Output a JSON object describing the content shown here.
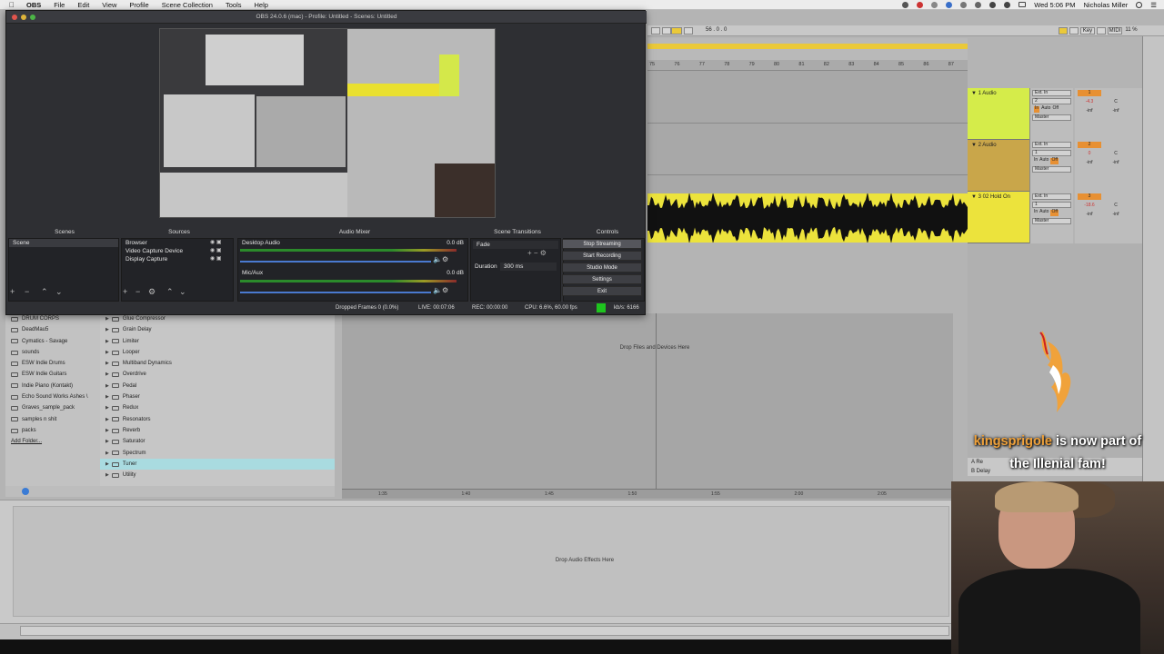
{
  "menubar": {
    "app": "OBS",
    "items": [
      "File",
      "Edit",
      "View",
      "Profile",
      "Scene Collection",
      "Tools",
      "Help"
    ],
    "clock": "Wed 5:06 PM",
    "user": "Nicholas Miller"
  },
  "obs": {
    "title": "OBS 24.0.6 (mac) - Profile: Untitled - Scenes: Untitled",
    "docks": {
      "scenes": "Scenes",
      "sources": "Sources",
      "mixer": "Audio Mixer",
      "transitions": "Scene Transitions",
      "controls": "Controls"
    },
    "scenes": [
      "Scene"
    ],
    "sources": [
      "Browser",
      "Video Capture Device",
      "Display Capture"
    ],
    "mixer": [
      {
        "name": "Desktop Audio",
        "db": "0.0 dB"
      },
      {
        "name": "Mic/Aux",
        "db": "0.0 dB"
      }
    ],
    "transition": {
      "type": "Fade",
      "duration_label": "Duration",
      "duration": "300 ms"
    },
    "controls": [
      "Stop Streaming",
      "Start Recording",
      "Studio Mode",
      "Settings",
      "Exit"
    ],
    "status": {
      "dropped": "Dropped Frames 0 (0.0%)",
      "live": "LIVE: 00:07:06",
      "rec": "REC: 00:00:00",
      "cpu": "CPU: 6.6%, 60.00 fps",
      "kbps": "kb/s: 6166"
    },
    "live_color": "#1ec41e"
  },
  "ableton": {
    "toolbar": {
      "position": "56 . 0 . 0",
      "key": "Key",
      "midi": "MIDI",
      "cpu": "11 %"
    },
    "ruler": [
      "75",
      "76",
      "77",
      "78",
      "79",
      "80",
      "81",
      "82",
      "83",
      "84",
      "85",
      "86",
      "87"
    ],
    "tracks": [
      {
        "name": "1 Audio",
        "color": "#d5ec4a",
        "in": "Ext. In",
        "ch": "2",
        "out": "Master",
        "num": "1",
        "vol": "-4.3"
      },
      {
        "name": "2 Audio",
        "color": "#c9a64a",
        "in": "Ext. In",
        "ch": "1",
        "out": "Master",
        "num": "2",
        "vol": "0"
      },
      {
        "name": "3 02 Hold On",
        "color": "#ece33c",
        "in": "Ext. In",
        "ch": "1",
        "out": "Master",
        "num": "3",
        "vol": "-18.6"
      }
    ],
    "mix_labels": {
      "monitor_auto": "Auto",
      "monitor_off": "Off",
      "pan": "C",
      "inf": "-inf",
      "in": "In"
    },
    "returns": [
      "A Re",
      "B Delay"
    ],
    "drop_files": "Drop Files and Devices Here",
    "drop_fx": "Drop Audio Effects Here",
    "timeline": [
      "1:35",
      "1:40",
      "1:45",
      "1:50",
      "1:55",
      "2:00",
      "2:05"
    ],
    "browser": {
      "places": [
        "DRUM CORPS",
        "DeadMau5",
        "Cymatics - Savage",
        "sounds",
        "ESW Indie Drums",
        "ESW Indie Guitars",
        "Indie Piano (Kontakt)",
        "Echo Sound Works Ashes \\",
        "Graves_sample_pack",
        "samples n shit",
        "packs",
        "Add Folder..."
      ],
      "devices": [
        "Glue Compressor",
        "Grain Delay",
        "Limiter",
        "Looper",
        "Multiband Dynamics",
        "Overdrive",
        "Pedal",
        "Phaser",
        "Redux",
        "Resonators",
        "Reverb",
        "Saturator",
        "Spectrum",
        "Tuner",
        "Utility"
      ],
      "selected": "Tuner"
    }
  },
  "overlay": {
    "alert_user": "kingsprigole",
    "alert_line1": " is now part of",
    "alert_line2": "the Illenial fam!",
    "accent": "#f0a23b"
  }
}
